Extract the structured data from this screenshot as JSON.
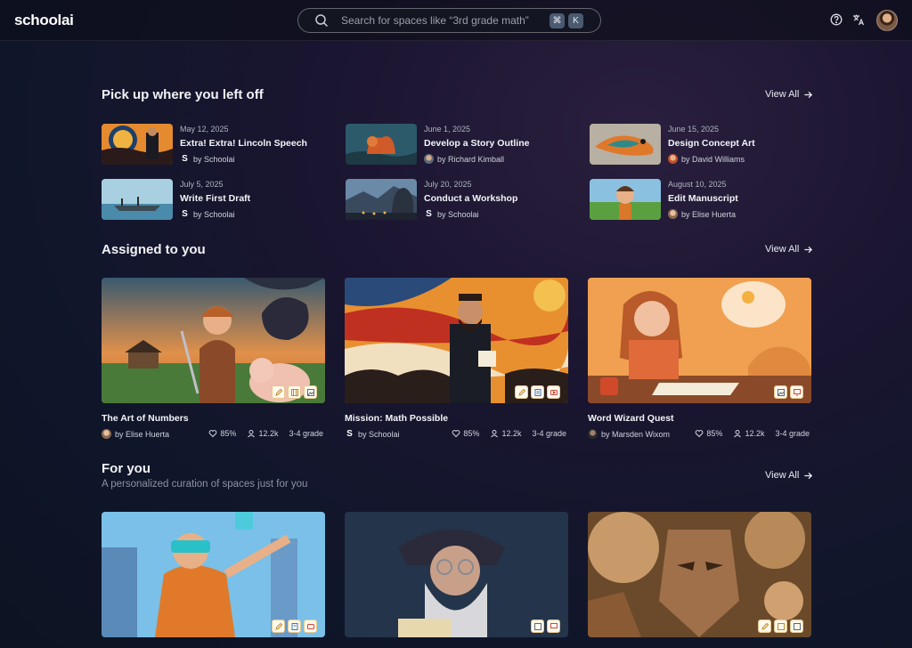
{
  "app": {
    "logo": "schoolai"
  },
  "search": {
    "placeholder": "Search for spaces like “3rd grade math”",
    "shortcut_mod": "⌘",
    "shortcut_key": "K"
  },
  "header_icons": [
    "help-icon",
    "translate-icon",
    "user-avatar"
  ],
  "sections": {
    "recent": {
      "title": "Pick up where you left off",
      "view_all": "View All"
    },
    "assigned": {
      "title": "Assigned to you",
      "view_all": "View All"
    },
    "for_you": {
      "title": "For you",
      "subtitle": "A personalized curation of spaces just for you",
      "view_all": "View All"
    }
  },
  "recent": [
    {
      "date": "May 12, 2025",
      "title": "Extra! Extra! Lincoln Speech",
      "author": "by Schoolai"
    },
    {
      "date": "June 1, 2025",
      "title": "Develop a Story Outline",
      "author": "by Richard Kimball"
    },
    {
      "date": "June 15, 2025",
      "title": "Design Concept Art",
      "author": "by David Williams"
    },
    {
      "date": "July 5, 2025",
      "title": "Write First Draft",
      "author": "by Schoolai"
    },
    {
      "date": "July 20, 2025",
      "title": "Conduct a Workshop",
      "author": "by Schoolai"
    },
    {
      "date": "August 10, 2025",
      "title": "Edit Manuscript",
      "author": "by Elise Huerta"
    }
  ],
  "assigned": [
    {
      "title": "The Art of Numbers",
      "author": "by Elise Huerta",
      "rating": "85%",
      "users": "12.2k",
      "grade": "3-4 grade"
    },
    {
      "title": "Mission: Math Possible",
      "author": "by Schoolai",
      "rating": "85%",
      "users": "12.2k",
      "grade": "3-4 grade"
    },
    {
      "title": "Word Wizard Quest",
      "author": "by Marsden Wixom",
      "rating": "85%",
      "users": "12.2k",
      "grade": "3-4 grade"
    }
  ],
  "colors": {
    "accent_badge_border": "#e7c98f",
    "background": "#10162a"
  }
}
